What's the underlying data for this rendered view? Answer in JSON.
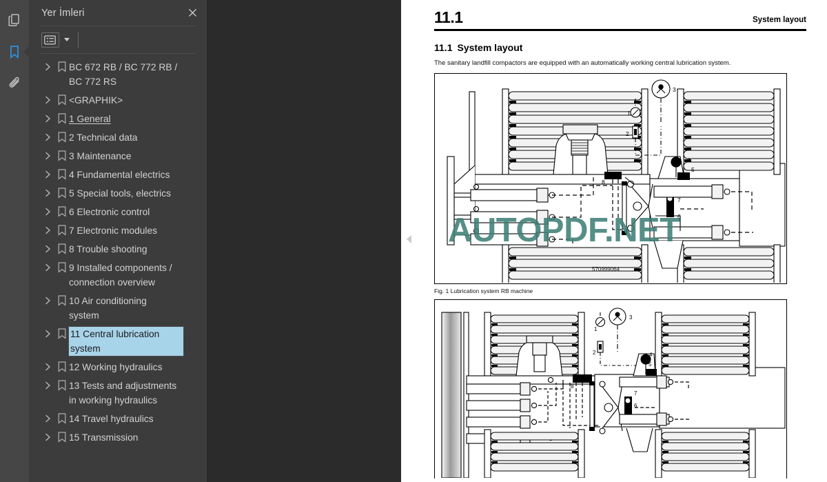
{
  "app": {
    "accent_blue": "#2f8fd8",
    "panel_bg": "#3c3c3c",
    "rail_bg": "#464646",
    "viewer_bg": "#2b2b2b",
    "selection_bg": "#a8d4ea",
    "watermark_color": "#3e8077"
  },
  "rail": {
    "items": [
      {
        "name": "thumbnails-icon",
        "title": "Sayfa Küçük Resimleri",
        "active": false
      },
      {
        "name": "bookmarks-icon",
        "title": "Yer İmleri",
        "active": true
      },
      {
        "name": "attachments-icon",
        "title": "Ekler",
        "active": false
      }
    ]
  },
  "panel": {
    "title": "Yer İmleri",
    "close_label": "✕",
    "toolbar": {
      "options_label": "Seçenekler",
      "caret": "▾"
    },
    "tree": [
      {
        "label": "BC 672 RB / BC 772 RB / BC 772 RS",
        "selected": false,
        "underline": false
      },
      {
        "label": "<GRAPHIK>",
        "selected": false,
        "underline": false
      },
      {
        "label": "1 General",
        "selected": false,
        "underline": true
      },
      {
        "label": "2 Technical data",
        "selected": false,
        "underline": false
      },
      {
        "label": "3 Maintenance",
        "selected": false,
        "underline": false
      },
      {
        "label": "4 Fundamental electrics",
        "selected": false,
        "underline": false
      },
      {
        "label": "5 Special tools, electrics",
        "selected": false,
        "underline": false
      },
      {
        "label": "6 Electronic control",
        "selected": false,
        "underline": false
      },
      {
        "label": "7 Electronic modules",
        "selected": false,
        "underline": false
      },
      {
        "label": "8 Trouble shooting",
        "selected": false,
        "underline": false
      },
      {
        "label": "9 Installed components / connection overview",
        "selected": false,
        "underline": false
      },
      {
        "label": "10 Air conditioning system",
        "selected": false,
        "underline": false
      },
      {
        "label": "11 Central lubrication system",
        "selected": true,
        "underline": false
      },
      {
        "label": "12 Working hydraulics",
        "selected": false,
        "underline": false
      },
      {
        "label": "13 Tests and adjustments in working hydraulics",
        "selected": false,
        "underline": false
      },
      {
        "label": "14 Travel hydraulics",
        "selected": false,
        "underline": false
      },
      {
        "label": "15 Transmission",
        "selected": false,
        "underline": false
      }
    ],
    "scrollbar": {
      "thumb_top_pct": 1,
      "thumb_height_pct": 66
    }
  },
  "viewer": {
    "collapse_handle": "◀",
    "watermark": "AUTOPDF.NET",
    "document": {
      "header_number": "11.1",
      "header_right": "System layout",
      "section_number": "11.1",
      "section_title": "System layout",
      "paragraph": "The sanitary landfill compactors are equipped with an automatically working central lubrication system.",
      "figures": [
        {
          "part_number": "570999064",
          "caption": "Fig. 1 Lubrication system RB machine",
          "callouts": [
            "1",
            "2",
            "3",
            "4",
            "5",
            "6",
            "7",
            "8"
          ]
        },
        {
          "part_number": "",
          "caption": "",
          "callouts": [
            "1",
            "2",
            "3",
            "4",
            "5",
            "6",
            "7",
            "8"
          ]
        }
      ]
    }
  }
}
